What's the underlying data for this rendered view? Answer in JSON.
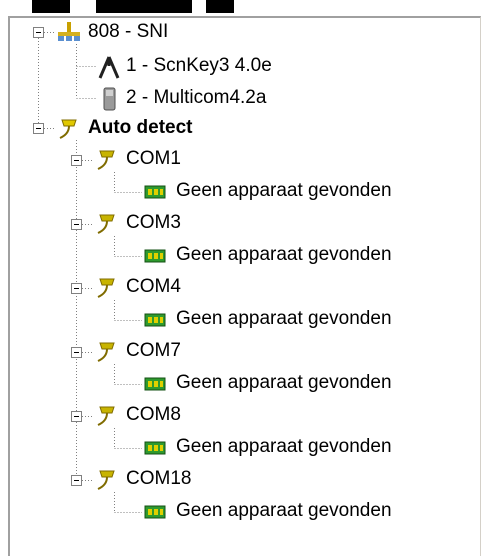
{
  "tree": {
    "root": {
      "label": "808 - SNI"
    },
    "root_children": [
      {
        "label": "1 - ScnKey3 4.0e",
        "icon": "scanner-tripod-icon"
      },
      {
        "label": "2 - Multicom4.2a",
        "icon": "handheld-device-icon"
      }
    ],
    "auto_detect": {
      "label": "Auto detect"
    },
    "ports": [
      {
        "label": "COM1",
        "child": "Geen apparaat gevonden"
      },
      {
        "label": "COM3",
        "child": "Geen apparaat gevonden"
      },
      {
        "label": "COM4",
        "child": "Geen apparaat gevonden"
      },
      {
        "label": "COM7",
        "child": "Geen apparaat gevonden"
      },
      {
        "label": "COM8",
        "child": "Geen apparaat gevonden"
      },
      {
        "label": "COM18",
        "child": "Geen apparaat gevonden"
      }
    ]
  },
  "colors": {
    "serial_icon": "#c8b400",
    "board_icon": "#2e9a2e",
    "line": "#808080"
  }
}
